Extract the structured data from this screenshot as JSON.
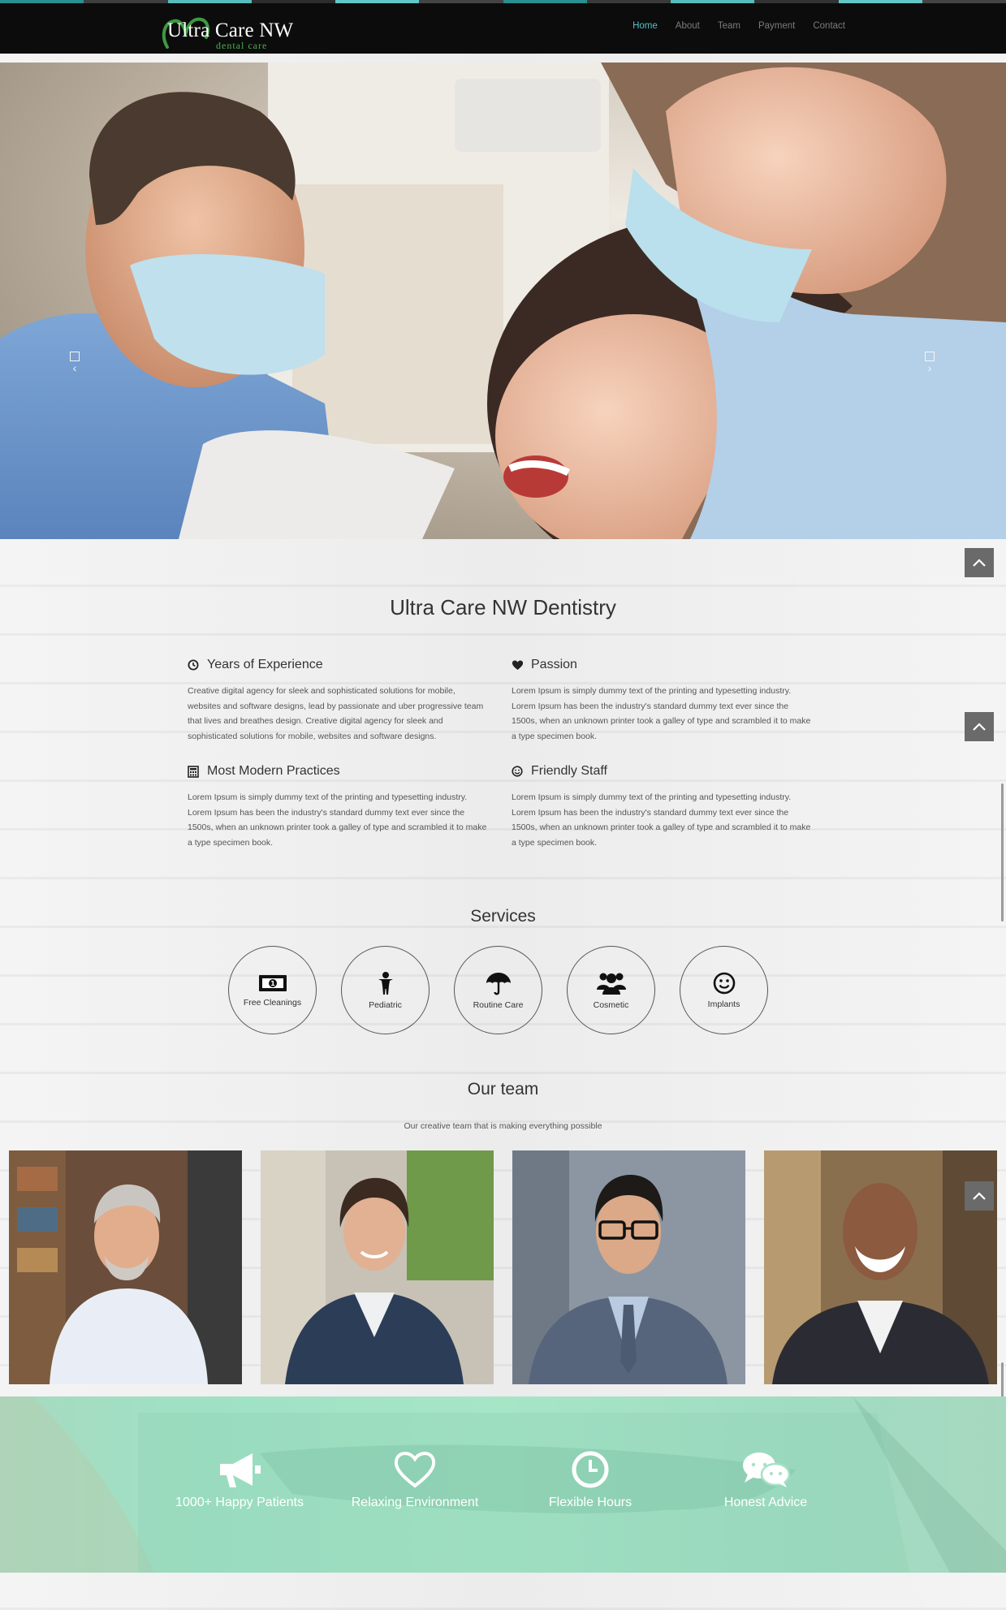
{
  "brand": {
    "name": "Ultra Care NW",
    "tagline": "dental care",
    "accent_color": "#4fc3c7",
    "logo_green": "#4cae4f"
  },
  "nav": {
    "items": [
      {
        "label": "Home",
        "active": true
      },
      {
        "label": "About",
        "active": false
      },
      {
        "label": "Team",
        "active": false
      },
      {
        "label": "Payment",
        "active": false
      },
      {
        "label": "Contact",
        "active": false
      }
    ]
  },
  "hero": {
    "prev_icon": "chevron-left-icon",
    "next_icon": "chevron-right-icon"
  },
  "about": {
    "title": "Ultra Care NW Dentistry",
    "features": [
      {
        "icon": "clock-icon",
        "title": "Years of Experience",
        "text": "Creative digital agency for sleek and sophisticated solutions for mobile, websites and software designs, lead by passionate and uber progressive team that lives and breathes design. Creative digital agency for sleek and sophisticated solutions for mobile, websites and software designs."
      },
      {
        "icon": "heart-icon",
        "title": "Passion",
        "text": "Lorem Ipsum is simply dummy text of the printing and typesetting industry. Lorem Ipsum has been the industry's standard dummy text ever since the 1500s, when an unknown printer took a galley of type and scrambled it to make a type specimen book."
      },
      {
        "icon": "calculator-icon",
        "title": "Most Modern Practices",
        "text": "Lorem Ipsum is simply dummy text of the printing and typesetting industry. Lorem Ipsum has been the industry's standard dummy text ever since the 1500s, when an unknown printer took a galley of type and scrambled it to make a type specimen book."
      },
      {
        "icon": "smile-icon",
        "title": "Friendly Staff",
        "text": "Lorem Ipsum is simply dummy text of the printing and typesetting industry. Lorem Ipsum has been the industry's standard dummy text ever since the 1500s, when an unknown printer took a galley of type and scrambled it to make a type specimen book."
      }
    ]
  },
  "services": {
    "title": "Services",
    "items": [
      {
        "icon": "money-icon",
        "label": "Free Cleanings"
      },
      {
        "icon": "child-icon",
        "label": "Pediatric"
      },
      {
        "icon": "umbrella-icon",
        "label": "Routine Care"
      },
      {
        "icon": "users-icon",
        "label": "Cosmetic"
      },
      {
        "icon": "smile-icon",
        "label": "Implants"
      }
    ]
  },
  "team": {
    "title": "Our team",
    "subtitle": "Our creative team that is making everything possible"
  },
  "stats": {
    "items": [
      {
        "icon": "megaphone-icon",
        "label": "1000+ Happy Patients"
      },
      {
        "icon": "heart-outline-icon",
        "label": "Relaxing Environment"
      },
      {
        "icon": "clock-icon",
        "label": "Flexible Hours"
      },
      {
        "icon": "chat-bubbles-icon",
        "label": "Honest Advice"
      }
    ]
  }
}
